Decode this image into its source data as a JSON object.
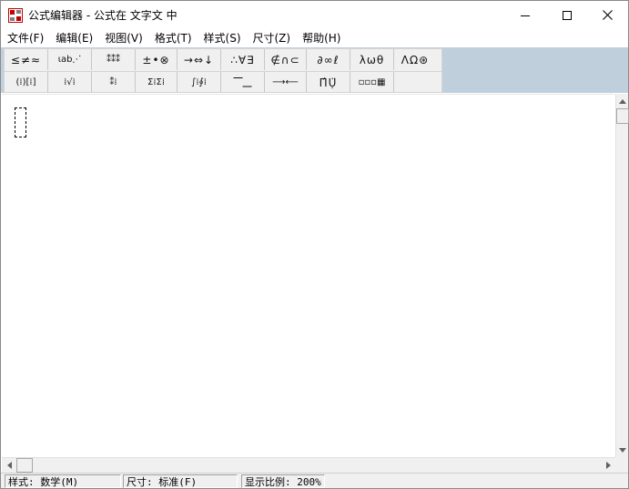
{
  "window": {
    "title": "公式编辑器 - 公式在 文字文 中"
  },
  "menu": {
    "items": [
      {
        "label": "文件(F)"
      },
      {
        "label": "编辑(E)"
      },
      {
        "label": "视图(V)"
      },
      {
        "label": "格式(T)"
      },
      {
        "label": "样式(S)"
      },
      {
        "label": "尺寸(Z)"
      },
      {
        "label": "帮助(H)"
      }
    ]
  },
  "palette": {
    "row1": [
      {
        "glyph": "≤≠≈",
        "name": "relations-palette"
      },
      {
        "glyph": "⍳ab⋰",
        "name": "spaces-ellipses-palette"
      },
      {
        "glyph": "⁑⁑⁑",
        "name": "embellishments-palette"
      },
      {
        "glyph": "±•⊗",
        "name": "operators-palette"
      },
      {
        "glyph": "→⇔↓",
        "name": "arrows-palette"
      },
      {
        "glyph": "∴∀∃",
        "name": "logic-palette"
      },
      {
        "glyph": "∉∩⊂",
        "name": "set-theory-palette"
      },
      {
        "glyph": "∂∞ℓ",
        "name": "misc-symbols-palette"
      },
      {
        "glyph": "λωθ",
        "name": "greek-lowercase-palette"
      },
      {
        "glyph": "ΛΩ⊛",
        "name": "greek-uppercase-palette"
      }
    ],
    "row2": [
      {
        "glyph": "(⁞)[⁞]",
        "name": "fences-template"
      },
      {
        "glyph": "⁞√⁞",
        "name": "fractions-radicals-template"
      },
      {
        "glyph": "⁑⁞",
        "name": "subscript-superscript-template"
      },
      {
        "glyph": "Σ⁞Σ⁞",
        "name": "summation-template"
      },
      {
        "glyph": "∫⁞∮⁞",
        "name": "integrals-template"
      },
      {
        "glyph": "⎺⎽",
        "name": "underbar-overbar-template"
      },
      {
        "glyph": "⟶⟵",
        "name": "labeled-arrows-template"
      },
      {
        "glyph": "Π̂Ụ̈",
        "name": "products-set-template"
      },
      {
        "glyph": "▫▫▫▦",
        "name": "matrices-template"
      }
    ]
  },
  "status": {
    "style": "样式: 数学(M)",
    "size": "尺寸: 标准(F)",
    "zoom": "显示比例: 200%"
  },
  "colors": {
    "toolbar_bg": "#c0cfdc",
    "palette_bg": "#f0f0f0",
    "app_icon": "#c00000"
  }
}
